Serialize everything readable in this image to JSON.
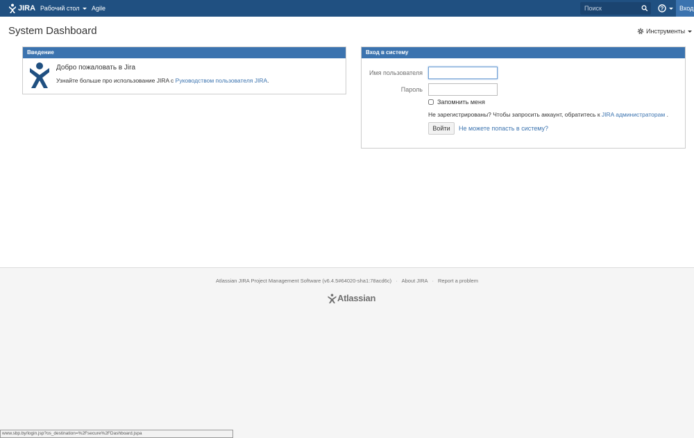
{
  "topbar": {
    "logo_text": "JIRA",
    "nav": {
      "dashboards": "Рабочий стол",
      "agile": "Agile"
    },
    "search_placeholder": "Поиск",
    "login": "Вход"
  },
  "page": {
    "title": "System Dashboard",
    "tools": "Инструменты"
  },
  "intro_gadget": {
    "heading": "Введение",
    "title": "Добро пожаловать в Jira",
    "text_before": "Узнайте больше про использование JIRA с ",
    "link": "Руководством пользователя JIRA",
    "text_after": "."
  },
  "login_gadget": {
    "heading": "Вход в систему",
    "username_label": "Имя пользователя",
    "password_label": "Пароль",
    "remember": "Запомнить меня",
    "not_registered": "Не зарегистрированы? Чтобы запросить аккаунт, обратитесь к ",
    "admins_link": "JIRA администраторам",
    "not_registered_end": " .",
    "login_button": "Войти",
    "forgot": "Не можете попасть в систему?"
  },
  "footer": {
    "version": "Atlassian JIRA Project Management Software (v6.4.5#64020-sha1:78acd6c)",
    "about": "About JIRA",
    "report": "Report a problem",
    "logo_text": "Atlassian"
  },
  "statusbar": {
    "url": "www.sbp.by/login.jsp?os_destination=%2Fsecure%2FDashboard.jspa"
  },
  "colors": {
    "topbar": "#205081",
    "accent": "#3b73af"
  }
}
